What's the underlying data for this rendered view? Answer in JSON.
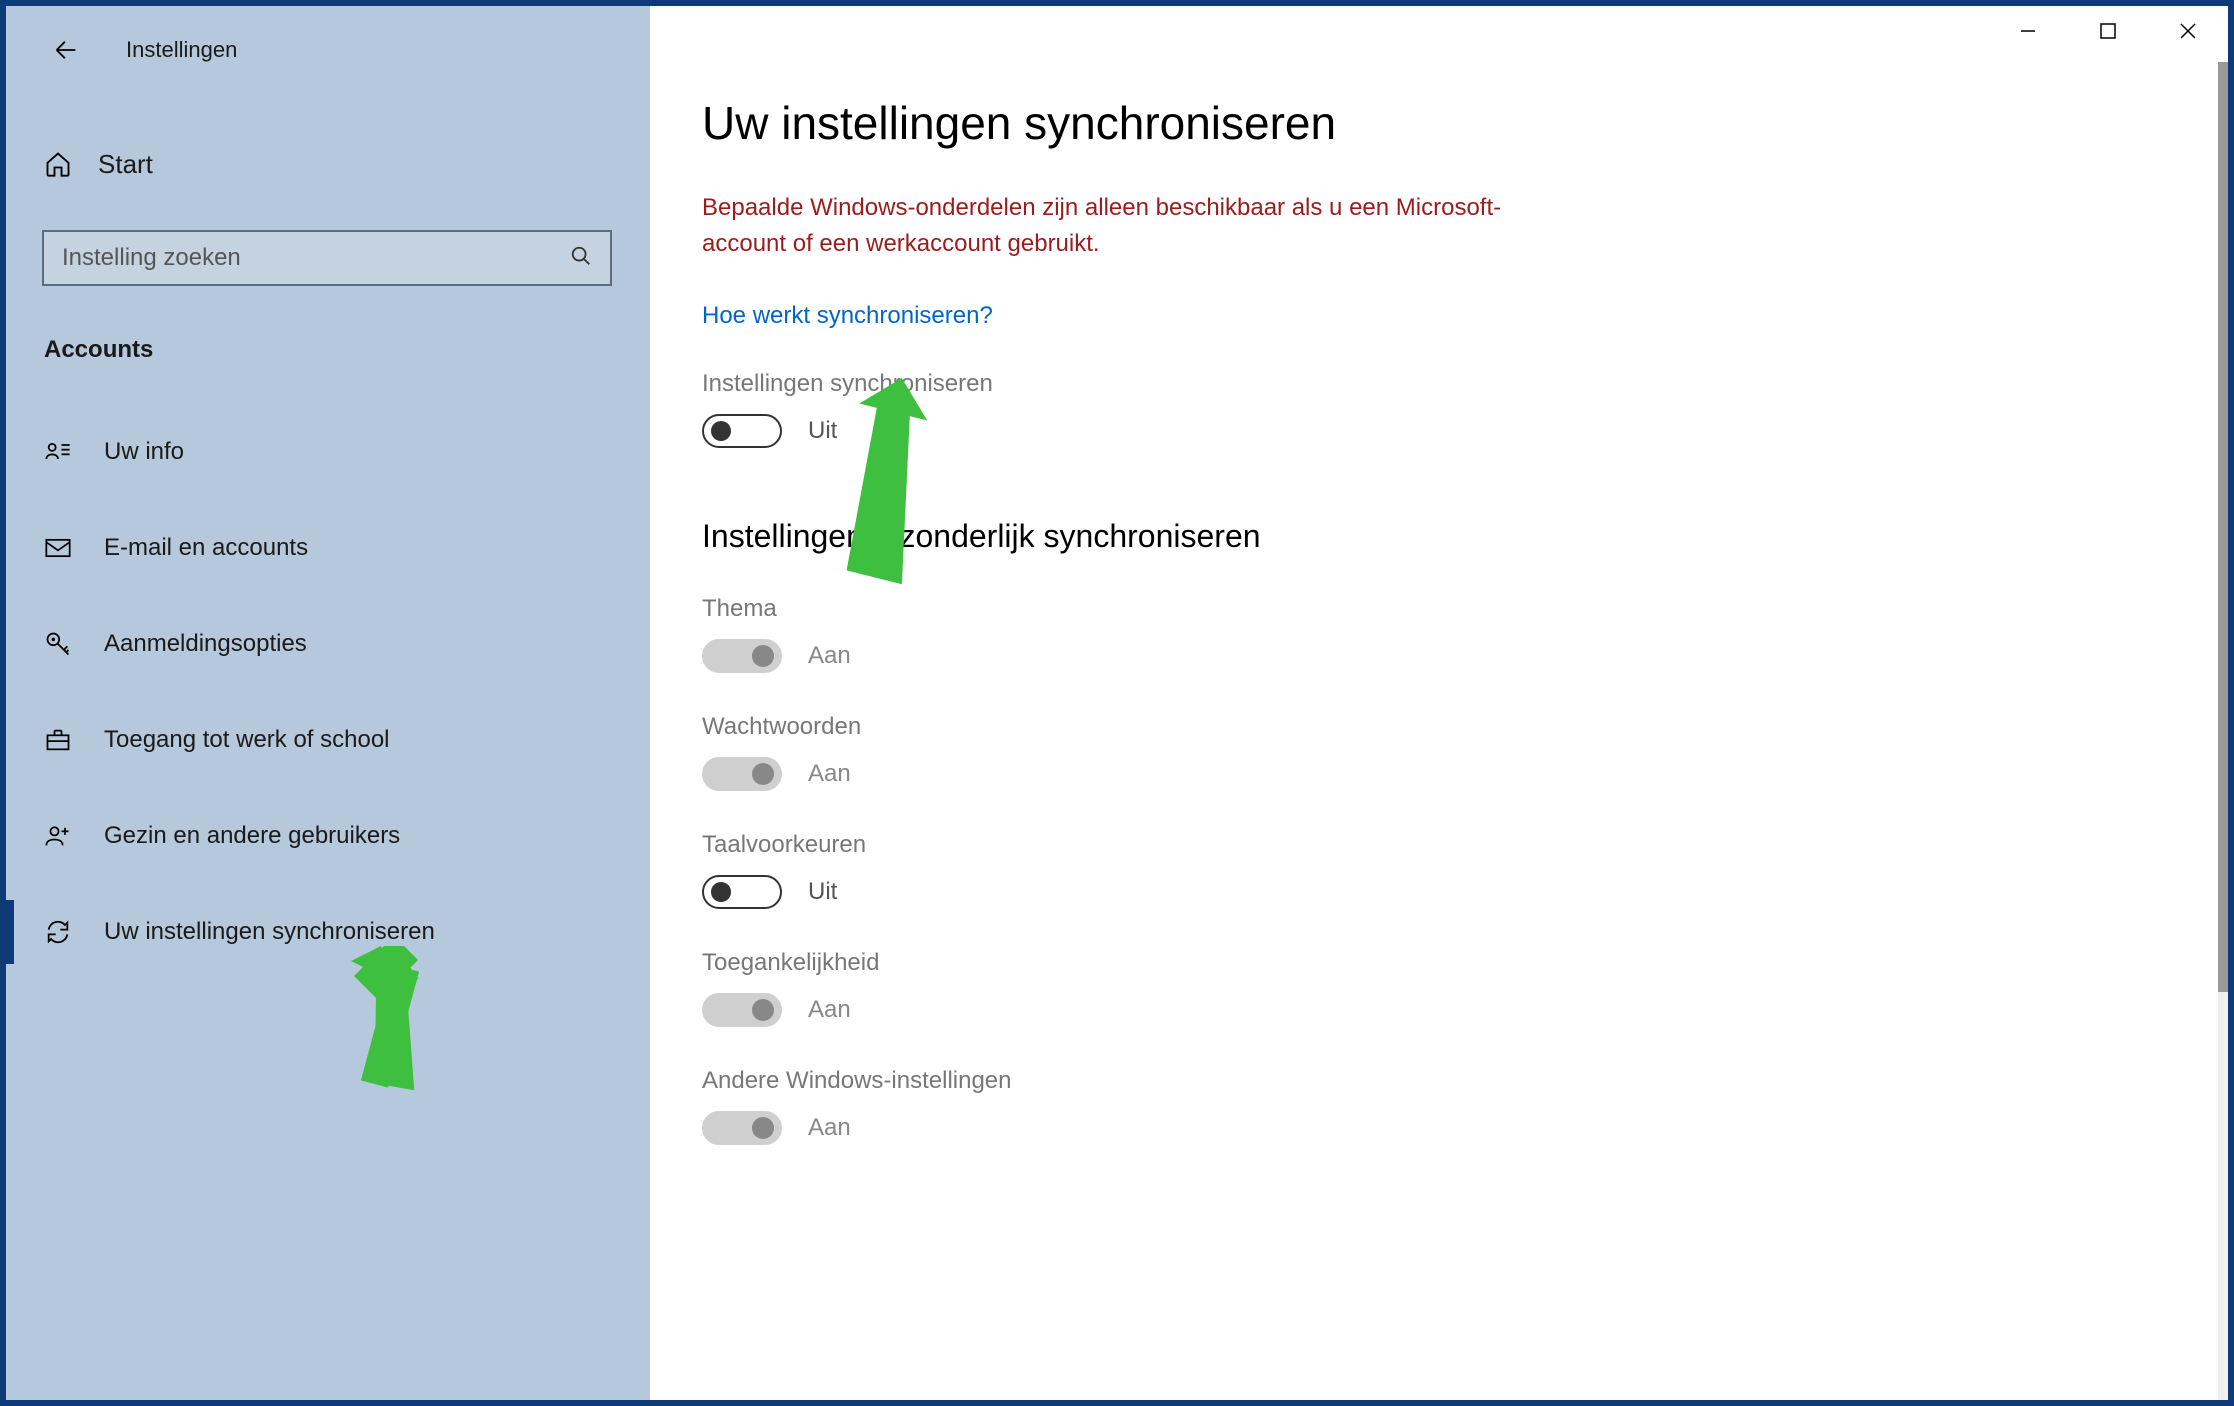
{
  "window": {
    "title": "Instellingen",
    "home": "Start",
    "search_placeholder": "Instelling zoeken",
    "section": "Accounts"
  },
  "nav": [
    {
      "label": "Uw info",
      "active": false
    },
    {
      "label": "E-mail en accounts",
      "active": false
    },
    {
      "label": "Aanmeldingsopties",
      "active": false
    },
    {
      "label": "Toegang tot werk of school",
      "active": false
    },
    {
      "label": "Gezin en andere gebruikers",
      "active": false
    },
    {
      "label": "Uw instellingen synchroniseren",
      "active": true
    }
  ],
  "main": {
    "title": "Uw instellingen synchroniseren",
    "warning": "Bepaalde Windows-onderdelen zijn alleen beschikbaar als u een Microsoft-account of een werkaccount gebruikt.",
    "link": "Hoe werkt synchroniseren?",
    "sync_label": "Instellingen synchroniseren",
    "sync_state": "Uit",
    "subtitle": "Instellingen afzonderlijk synchroniseren",
    "items": [
      {
        "label": "Thema",
        "state": "Aan",
        "toggle": "disabled-on"
      },
      {
        "label": "Wachtwoorden",
        "state": "Aan",
        "toggle": "disabled-on"
      },
      {
        "label": "Taalvoorkeuren",
        "state": "Uit",
        "toggle": "disabled-off"
      },
      {
        "label": "Toegankelijkheid",
        "state": "Aan",
        "toggle": "disabled-on"
      },
      {
        "label": "Andere Windows-instellingen",
        "state": "Aan",
        "toggle": "disabled-on"
      }
    ]
  }
}
